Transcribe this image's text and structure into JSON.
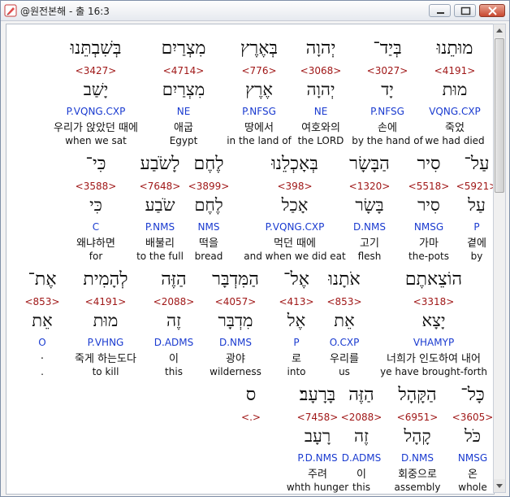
{
  "window": {
    "title": "@원전본해 - 출 16:3",
    "icon": "pencil-app-icon",
    "buttons": {
      "minimize": "minimize-icon",
      "maximize": "maximize-icon",
      "close": "close-icon"
    }
  },
  "rows": [
    {
      "words": [
        {
          "hebrew": "בְּשִׁבְתֵּנוּ",
          "strong": "<3427>",
          "lemma": "יָשַׁב",
          "morph": "P.VQNG.CXP",
          "korean": "우리가 앉았던 때에",
          "english": "when we sat"
        },
        {
          "hebrew": "מִצְרַיִם",
          "strong": "<4714>",
          "lemma": "מִצְרַיִם",
          "morph": "NE",
          "korean": "애굽",
          "english": "Egypt"
        },
        {
          "hebrew": "בְּאֶרֶץ",
          "strong": "<776>",
          "lemma": "אֶרֶץ",
          "morph": "P.NFSG",
          "korean": "땅에서",
          "english": "in the land of"
        },
        {
          "hebrew": "יְהוָה",
          "strong": "<3068>",
          "lemma": "יְהוָה",
          "morph": "NE",
          "korean": "여호와의",
          "english": "the LORD"
        },
        {
          "hebrew": "בְּיַד־",
          "strong": "<3027>",
          "lemma": "יָד",
          "morph": "P.NFSG",
          "korean": "손에",
          "english": "by the hand of"
        },
        {
          "hebrew": "מוּתֵנוּ",
          "strong": "<4191>",
          "lemma": "מוּת",
          "morph": "VQNG.CXP",
          "korean": "죽었",
          "english": "we had died"
        }
      ]
    },
    {
      "words": [
        {
          "hebrew": "כִּי־",
          "strong": "<3588>",
          "lemma": "כִּי",
          "morph": "C",
          "korean": "왜냐하면",
          "english": "for"
        },
        {
          "hebrew": "לָשֹׂבַע",
          "strong": "<7648>",
          "lemma": "שֹׂבַע",
          "morph": "P.NMS",
          "korean": "배불리",
          "english": "to the full"
        },
        {
          "hebrew": "לֶחֶם",
          "strong": "<3899>",
          "lemma": "לֶחֶם",
          "morph": "NMS",
          "korean": "떡을",
          "english": "bread"
        },
        {
          "hebrew": "בְּאָכְלֵנוּ",
          "strong": "<398>",
          "lemma": "אָכַל",
          "morph": "P.VQNG.CXP",
          "korean": "먹던 때에",
          "english": "and when we did eat"
        },
        {
          "hebrew": "הַבָּשָׂר",
          "strong": "<1320>",
          "lemma": "בָּשָׂר",
          "morph": "D.NMS",
          "korean": "고기",
          "english": "flesh"
        },
        {
          "hebrew": "סִיר",
          "strong": "<5518>",
          "lemma": "סִיר",
          "morph": "NMSG",
          "korean": "가마",
          "english": "the-pots"
        },
        {
          "hebrew": "עַל־",
          "strong": "<5921>",
          "lemma": "עַל",
          "morph": "P",
          "korean": "곁에",
          "english": "by"
        }
      ]
    },
    {
      "words": [
        {
          "hebrew": "אֶת־",
          "strong": "<853>",
          "lemma": "אֵת",
          "morph": "O",
          "korean": ".",
          "english": "."
        },
        {
          "hebrew": "לְהָמִית",
          "strong": "<4191>",
          "lemma": "מוּת",
          "morph": "P.VHNG",
          "korean": "죽게 하는도다",
          "english": "to kill"
        },
        {
          "hebrew": "הַזֶּה",
          "strong": "<2088>",
          "lemma": "זֶה",
          "morph": "D.ADMS",
          "korean": "이",
          "english": "this"
        },
        {
          "hebrew": "הַמִּדְבָּר",
          "strong": "<4057>",
          "lemma": "מִדְבָּר",
          "morph": "D.NMS",
          "korean": "광야",
          "english": "wilderness"
        },
        {
          "hebrew": "אֶל־",
          "strong": "<413>",
          "lemma": "אֶל",
          "morph": "P",
          "korean": "로",
          "english": "into"
        },
        {
          "hebrew": "אֹתָנוּ",
          "strong": "<853>",
          "lemma": "אֵת",
          "morph": "O.CXP",
          "korean": "우리를",
          "english": "us"
        },
        {
          "hebrew": "הוֹצֵאתֶם",
          "strong": "<3318>",
          "lemma": "יָצָא",
          "morph": "VHAMYP",
          "korean": "너희가 인도하여 내어",
          "english": "ye have brought-forth"
        }
      ]
    },
    {
      "words": [
        {
          "hebrew": "ס",
          "strong": "<.>",
          "lemma": "",
          "morph": "",
          "korean": "",
          "english": ""
        },
        {
          "hebrew": "בָּרָעָב׃",
          "strong": "<7458>",
          "lemma": "רָעָב",
          "morph": "P.D.NMS",
          "korean": "주려",
          "english": "whth hunger"
        },
        {
          "hebrew": "הַזֶּה",
          "strong": "<2088>",
          "lemma": "זֶה",
          "morph": "D.ADMS",
          "korean": "이",
          "english": "this"
        },
        {
          "hebrew": "הַקָּהָל",
          "strong": "<6951>",
          "lemma": "קָהָל",
          "morph": "D.NMS",
          "korean": "회중으로",
          "english": "assembly"
        },
        {
          "hebrew": "כָּל־",
          "strong": "<3605>",
          "lemma": "כֹּל",
          "morph": "NMSG",
          "korean": "온",
          "english": "whole"
        }
      ]
    }
  ]
}
